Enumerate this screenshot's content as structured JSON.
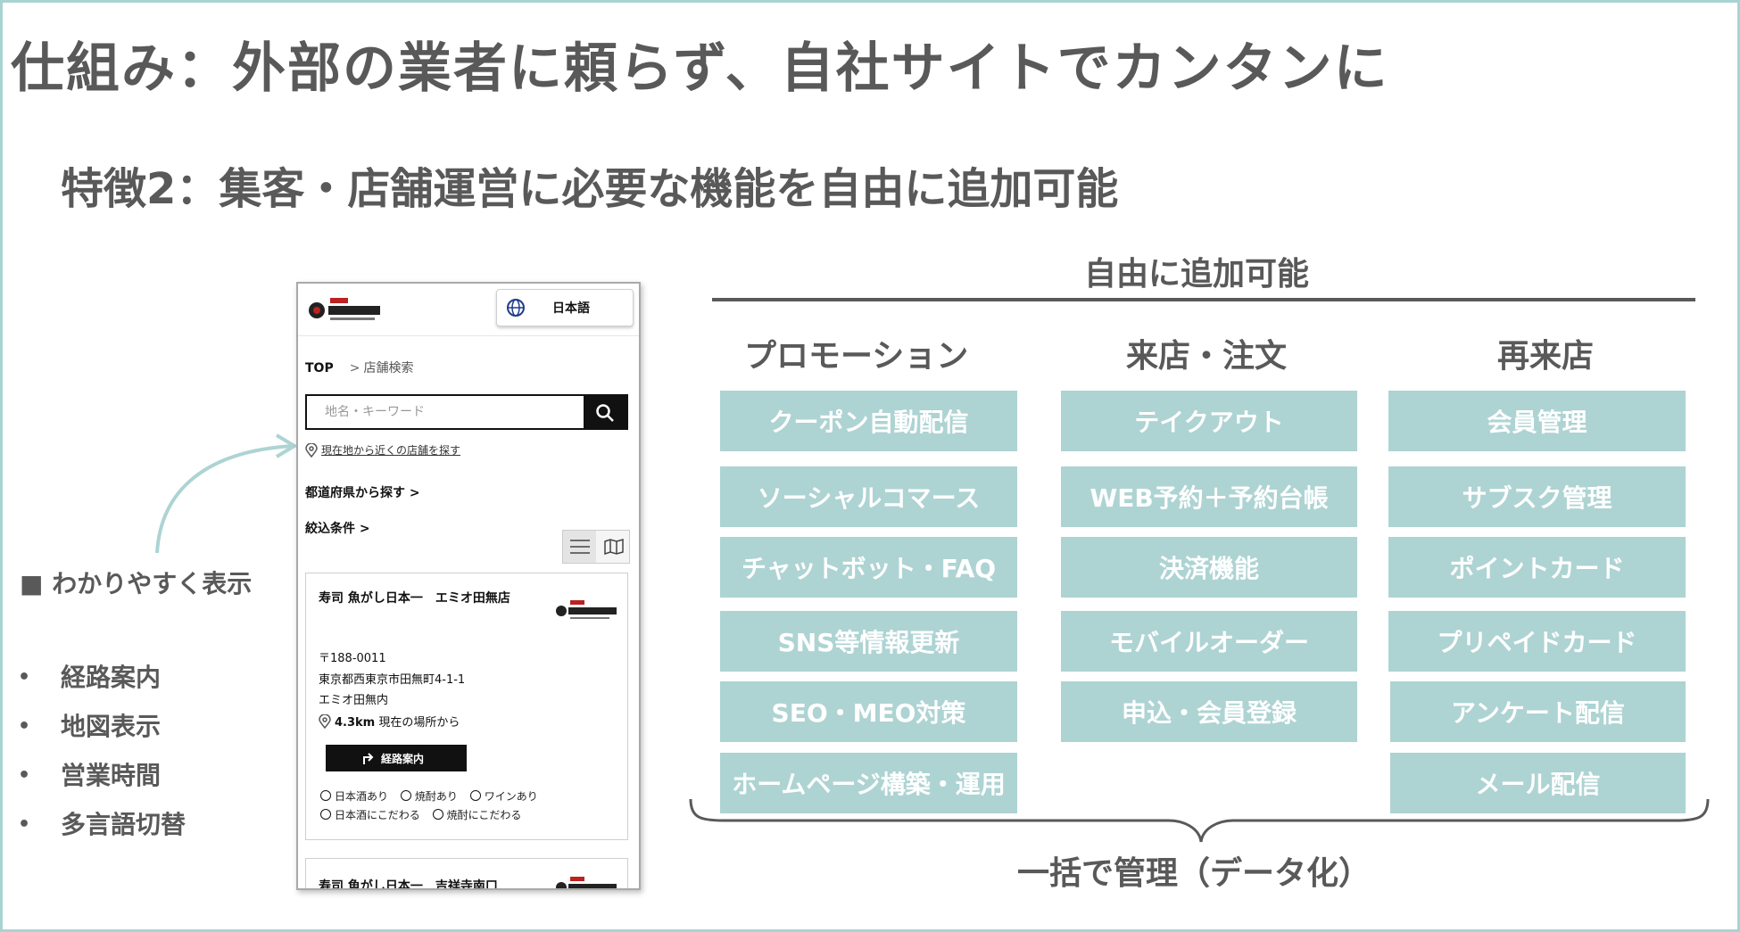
{
  "title": "仕組み：外部の業者に頼らず、自社サイトでカンタンに",
  "subtitle": "特徴2：集客・店舗運営に必要な機能を自由に追加可能",
  "left": {
    "heading": "■ わかりやすく表示",
    "bullet_glyph": "•",
    "bullets": [
      "経路案内",
      "地図表示",
      "営業時間",
      "多言語切替"
    ]
  },
  "phone": {
    "language": "日本語",
    "breadcrumb": {
      "top": "TOP",
      "separator": ">",
      "current": "店舗検索"
    },
    "search_placeholder": "地名・キーワード",
    "nearby_link": "現在地から近くの店舗を探す",
    "prefecture_link": "都道府県から探す",
    "refine_link": "絞込条件",
    "chevron": ">",
    "store": {
      "name": "寿司 魚がし日本一　エミオ田無店",
      "zip": "〒188-0011",
      "address_line1": "東京都西東京市田無町4-1-1",
      "address_line2": "エミオ田無内",
      "distance": "4.3km",
      "distance_suffix": "現在の場所から",
      "route_button": "経路案内",
      "tags": [
        "日本酒あり",
        "焼酎あり",
        "ワインあり",
        "日本酒にこだわる",
        "焼酎にこだわる"
      ]
    },
    "store2": {
      "name": "寿司 魚がし日本一　吉祥寺南口"
    }
  },
  "features": {
    "heading": "自由に追加可能",
    "columns": [
      {
        "title": "プロモーション",
        "items": [
          "クーポン自動配信",
          "ソーシャルコマース",
          "チャットボット・FAQ",
          "SNS等情報更新",
          "SEO・MEO対策",
          "ホームページ構築・運用"
        ]
      },
      {
        "title": "来店・注文",
        "items": [
          "テイクアウト",
          "WEB予約＋予約台帳",
          "決済機能",
          "モバイルオーダー",
          "申込・会員登録"
        ]
      },
      {
        "title": "再来店",
        "items": [
          "会員管理",
          "サブスク管理",
          "ポイントカード",
          "プリペイドカード",
          "アンケート配信",
          "メール配信"
        ]
      }
    ],
    "footer": "一括で管理（データ化）"
  },
  "colors": {
    "accent": "#aed3d3",
    "text": "#595959",
    "frame": "#a8d3d3"
  },
  "icons": [
    "globe-icon",
    "search-icon",
    "location-pin-icon",
    "list-view-icon",
    "map-view-icon",
    "turn-right-icon"
  ]
}
